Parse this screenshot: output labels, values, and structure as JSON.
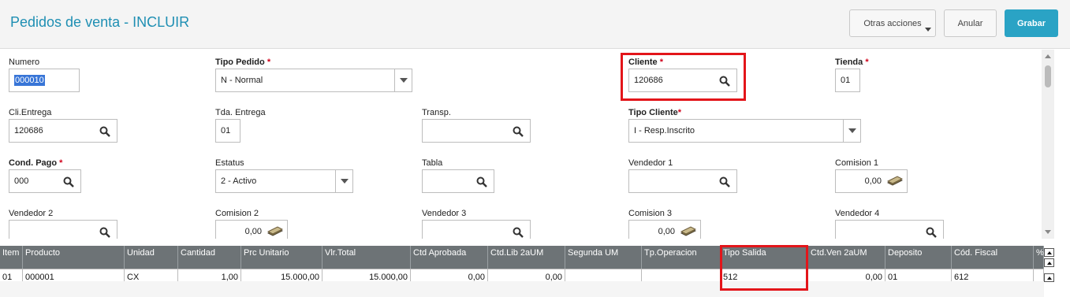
{
  "header": {
    "title": "Pedidos de venta - INCLUIR",
    "buttons": {
      "otras": "Otras acciones",
      "anular": "Anular",
      "grabar": "Grabar"
    }
  },
  "form": {
    "numero": {
      "label": "Numero",
      "value": "000010"
    },
    "tipo_pedido": {
      "label": "Tipo Pedido",
      "value": "N - Normal"
    },
    "cliente": {
      "label": "Cliente",
      "value": "120686"
    },
    "tienda": {
      "label": "Tienda",
      "value": "01"
    },
    "cli_entrega": {
      "label": "Cli.Entrega",
      "value": "120686"
    },
    "tda_entrega": {
      "label": "Tda. Entrega",
      "value": "01"
    },
    "transp": {
      "label": "Transp.",
      "value": ""
    },
    "tipo_cliente": {
      "label": "Tipo Cliente",
      "value": "I - Resp.Inscrito"
    },
    "cond_pago": {
      "label": "Cond. Pago",
      "value": "000"
    },
    "estatus": {
      "label": "Estatus",
      "value": "2 - Activo"
    },
    "tabla": {
      "label": "Tabla",
      "value": ""
    },
    "vendedor1": {
      "label": "Vendedor 1",
      "value": ""
    },
    "comision1": {
      "label": "Comision 1",
      "value": "0,00"
    },
    "vendedor2": {
      "label": "Vendedor 2",
      "value": ""
    },
    "comision2": {
      "label": "Comision 2",
      "value": "0,00"
    },
    "vendedor3": {
      "label": "Vendedor 3",
      "value": ""
    },
    "comision3": {
      "label": "Comision 3",
      "value": "0,00"
    },
    "vendedor4": {
      "label": "Vendedor 4",
      "value": ""
    }
  },
  "required_marker": "*",
  "grid": {
    "columns": [
      "Item",
      "Producto",
      "Unidad",
      "Cantidad",
      "Prc Unitario",
      "Vlr.Total",
      "Ctd Aprobada",
      "Ctd.Lib 2aUM",
      "Segunda UM",
      "Tp.Operacion",
      "Tipo Salida",
      "Ctd.Ven 2aUM",
      "Deposito",
      "Cód. Fiscal",
      "%"
    ],
    "rows": [
      [
        "01",
        "000001",
        "CX",
        "1,00",
        "15.000,00",
        "15.000,00",
        "0,00",
        "0,00",
        "",
        "",
        "512",
        "0,00",
        "01",
        "612",
        ""
      ]
    ]
  },
  "colors": {
    "title": "#1f8fb3",
    "grabar": "#2aa3c5",
    "highlight": "#e3151a",
    "grid_header": "#6d7376"
  },
  "icons": [
    "search-icon",
    "dropdown-arrow-icon",
    "money-icon"
  ]
}
